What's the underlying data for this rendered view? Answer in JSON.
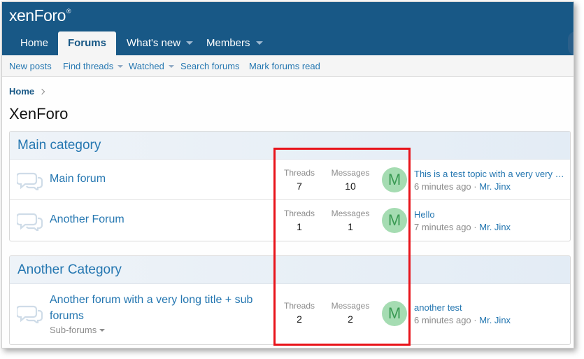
{
  "header": {
    "logo_text": "xenForo",
    "logo_mark": "®"
  },
  "nav": {
    "tabs": [
      {
        "label": "Home",
        "active": false,
        "has_menu": false
      },
      {
        "label": "Forums",
        "active": true,
        "has_menu": false
      },
      {
        "label": "What's new",
        "active": false,
        "has_menu": true
      },
      {
        "label": "Members",
        "active": false,
        "has_menu": true
      }
    ]
  },
  "subnav": {
    "links": [
      {
        "label": "New posts",
        "has_menu": false
      },
      {
        "label": "Find threads",
        "has_menu": true
      },
      {
        "label": "Watched",
        "has_menu": true
      },
      {
        "label": "Search forums",
        "has_menu": false
      },
      {
        "label": "Mark forums read",
        "has_menu": false
      }
    ]
  },
  "breadcrumb": {
    "home": "Home"
  },
  "page_title": "XenForo",
  "stat_labels": {
    "threads": "Threads",
    "messages": "Messages"
  },
  "categories": [
    {
      "title": "Main category",
      "forums": [
        {
          "title": "Main forum",
          "threads": "7",
          "messages": "10",
          "avatar_letter": "M",
          "latest_title": "This is a test topic with a very very …",
          "latest_time": "6 minutes ago",
          "latest_sep": "·",
          "latest_user": "Mr. Jinx"
        },
        {
          "title": "Another Forum",
          "threads": "1",
          "messages": "1",
          "avatar_letter": "M",
          "latest_title": "Hello",
          "latest_time": "7 minutes ago",
          "latest_sep": "·",
          "latest_user": "Mr. Jinx"
        }
      ]
    },
    {
      "title": "Another Category",
      "forums": [
        {
          "title": "Another forum with a very long title + sub forums",
          "subforums_label": "Sub-forums",
          "threads": "2",
          "messages": "2",
          "avatar_letter": "M",
          "latest_title": "another test",
          "latest_time": "6 minutes ago",
          "latest_sep": "·",
          "latest_user": "Mr. Jinx"
        }
      ]
    }
  ],
  "colors": {
    "header_bg": "#185886",
    "link": "#2577b1",
    "avatar_bg": "#a5dcb2",
    "avatar_fg": "#3a9a54",
    "highlight": "#e8131a"
  },
  "icons": {
    "forum": "chat-bubbles-icon",
    "dropdown": "caret-down-icon",
    "breadcrumb_sep": "chevron-right-icon"
  }
}
